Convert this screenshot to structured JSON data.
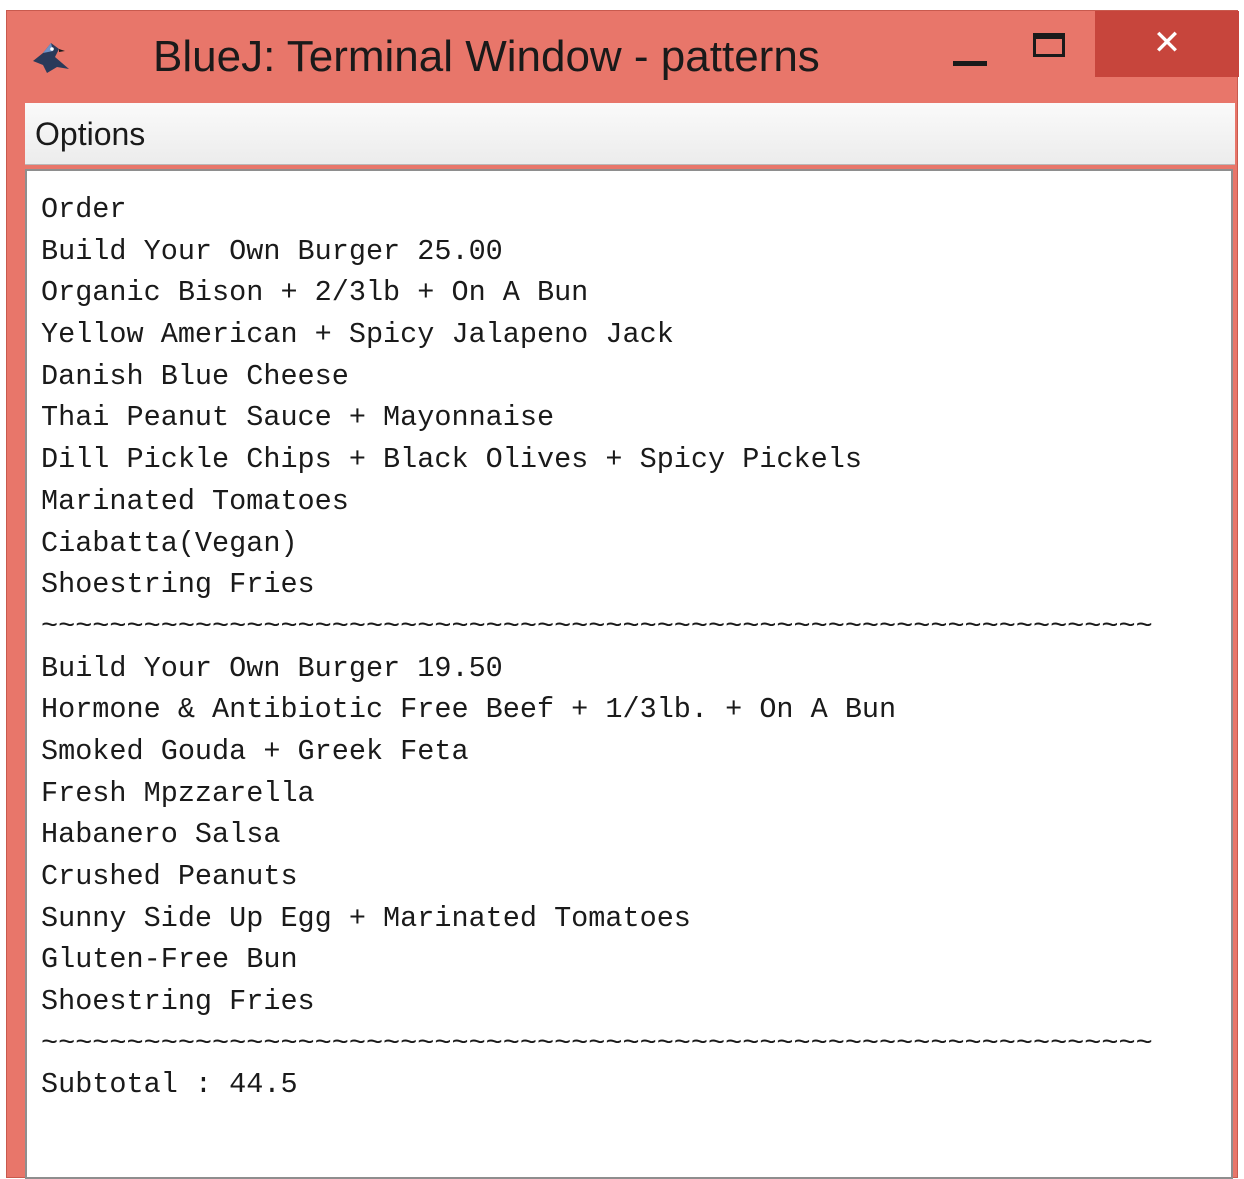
{
  "window": {
    "title": "BlueJ: Terminal Window - patterns",
    "icons": {
      "app": "bluej-bird-icon",
      "minimize": "minimize-icon",
      "maximize": "maximize-icon",
      "close": "close-icon"
    },
    "close_glyph": "✕",
    "colors": {
      "titlebar": "#e8766a",
      "close_button": "#c7453c"
    }
  },
  "menubar": {
    "options_label": "Options"
  },
  "terminal": {
    "lines": [
      "Order",
      "Build Your Own Burger 25.00",
      "Organic Bison + 2/3lb + On A Bun",
      "Yellow American + Spicy Jalapeno Jack",
      "Danish Blue Cheese",
      "Thai Peanut Sauce + Mayonnaise",
      "Dill Pickle Chips + Black Olives + Spicy Pickels",
      "Marinated Tomatoes",
      "Ciabatta(Vegan)",
      "Shoestring Fries",
      "~~~~~~~~~~~~~~~~~~~~~~~~~~~~~~~~~~~~~~~~~~~~~~~~~~~~~~~~~~~~~~~~~",
      "Build Your Own Burger 19.50",
      "Hormone & Antibiotic Free Beef + 1/3lb. + On A Bun",
      "Smoked Gouda + Greek Feta",
      "Fresh Mpzzarella",
      "Habanero Salsa",
      "Crushed Peanuts",
      "Sunny Side Up Egg + Marinated Tomatoes",
      "Gluten-Free Bun",
      "Shoestring Fries",
      "~~~~~~~~~~~~~~~~~~~~~~~~~~~~~~~~~~~~~~~~~~~~~~~~~~~~~~~~~~~~~~~~~",
      "Subtotal : 44.5"
    ]
  }
}
